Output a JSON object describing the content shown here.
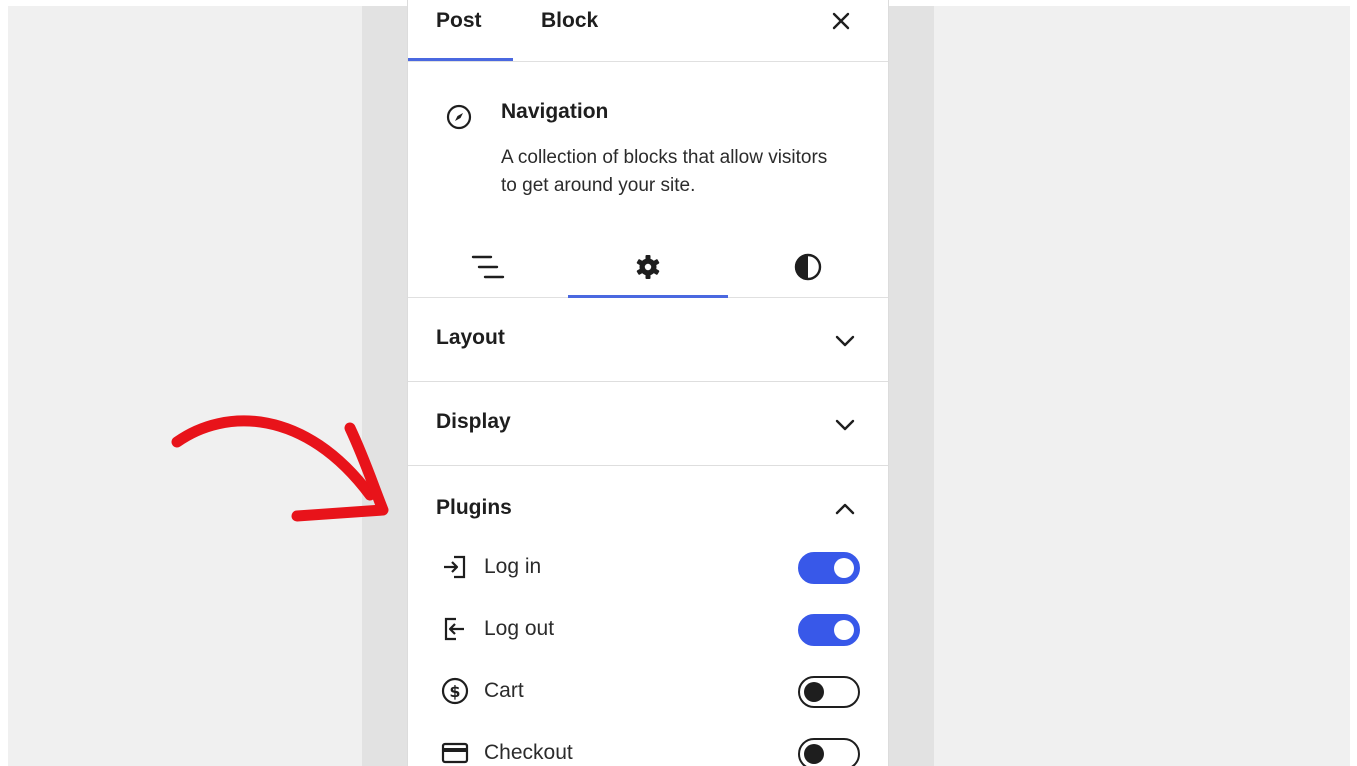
{
  "colors": {
    "accent": "#3858e9",
    "annotation_arrow": "#e8131a"
  },
  "tabs": {
    "post": "Post",
    "block": "Block"
  },
  "block": {
    "title": "Navigation",
    "description": "A collection of blocks that allow visitors to get around your site.",
    "icon": "compass-icon"
  },
  "sub_tabs": [
    {
      "icon": "list-view-icon"
    },
    {
      "icon": "gear-icon",
      "active": true
    },
    {
      "icon": "contrast-icon"
    }
  ],
  "sections": {
    "layout": "Layout",
    "display": "Display",
    "plugins": "Plugins"
  },
  "plugins": [
    {
      "label": "Log in",
      "icon": "login-icon",
      "enabled": true
    },
    {
      "label": "Log out",
      "icon": "logout-icon",
      "enabled": true
    },
    {
      "label": "Cart",
      "icon": "dollar-circle-icon",
      "enabled": false
    },
    {
      "label": "Checkout",
      "icon": "card-icon",
      "enabled": false
    }
  ]
}
